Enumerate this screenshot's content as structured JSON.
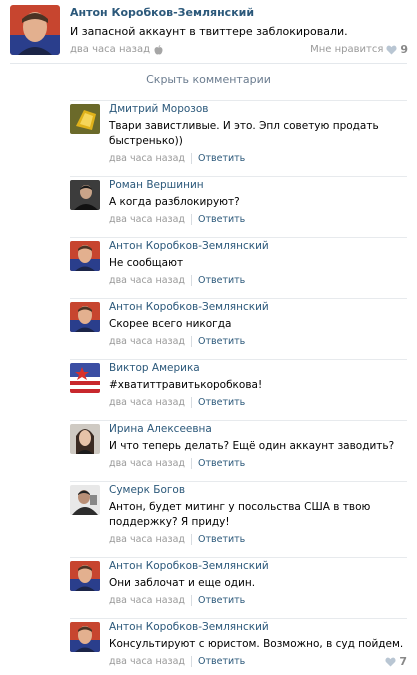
{
  "post": {
    "author": "Антон Коробков-Землянский",
    "text": "И запасной аккаунт в твиттере заблокировали.",
    "time": "два часа назад",
    "like_label": "Мне нравится",
    "like_count": "9"
  },
  "hide_comments": "Скрыть комментарии",
  "reply_label": "Ответить",
  "comments": [
    {
      "author": "Дмитрий Морозов",
      "text": "Твари завистливые. И это. Эпл советую продать быстренько))",
      "time": "два часа назад"
    },
    {
      "author": "Роман Вершинин",
      "text": "А когда разблокируют?",
      "time": "два часа назад"
    },
    {
      "author": "Антон Коробков-Землянский",
      "text": "Не сообщают",
      "time": "два часа назад"
    },
    {
      "author": "Антон Коробков-Землянский",
      "text": "Скорее всего никогда",
      "time": "два часа назад"
    },
    {
      "author": "Виктор Америка",
      "text": "#хватиттравитькоробкова!",
      "time": "два часа назад"
    },
    {
      "author": "Ирина Алексеевна",
      "text": "И что теперь делать? Ещё один аккаунт заводить?",
      "time": "два часа назад"
    },
    {
      "author": "Сумерк Богов",
      "text": "Антон, будет митинг у посольства США в твою поддержку? Я приду!",
      "time": "два часа назад"
    },
    {
      "author": "Антон Коробков-Землянский",
      "text": "Они заблочат и еще один.",
      "time": "два часа назад"
    },
    {
      "author": "Антон Коробков-Землянский",
      "text": "Консультируют с юристом. Возможно, в суд пойдем.",
      "time": "два часа назад",
      "like_count": "7"
    }
  ],
  "colors": {
    "link": "#2b587a",
    "meta": "#999999",
    "heart": "#b9c6d3"
  }
}
